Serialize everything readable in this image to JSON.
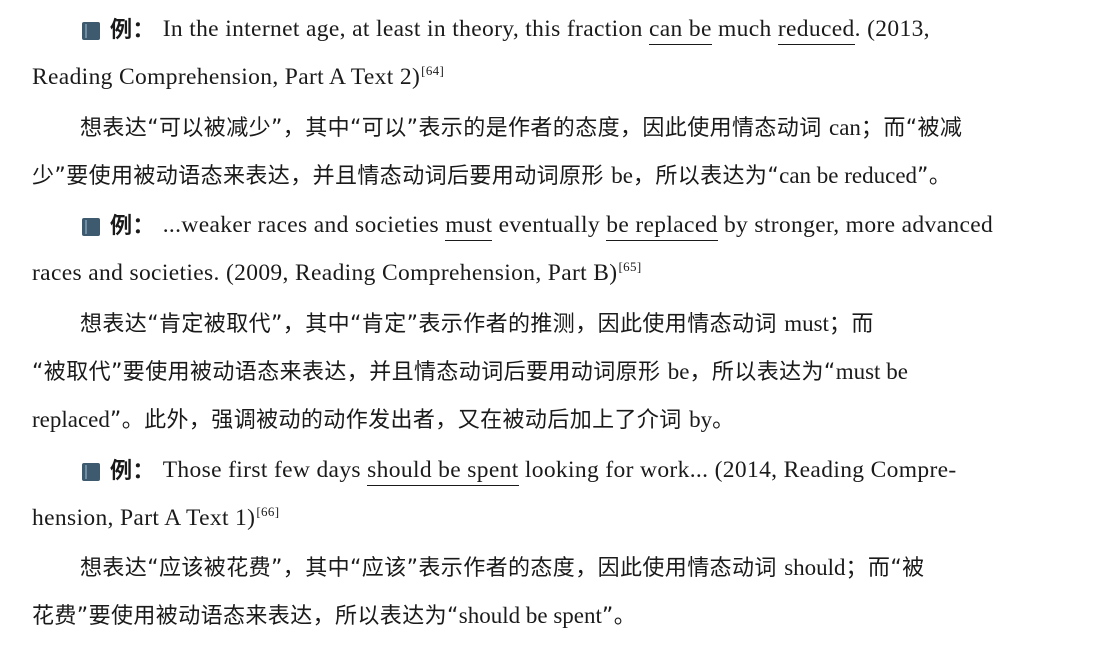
{
  "examples": [
    {
      "label": "例：",
      "sentence": {
        "l1": [
          "In the internet age, at least in theory, this fraction ",
          "can be",
          " much ",
          "reduced",
          ". (2013,"
        ],
        "l2": [
          "Reading Comprehension, Part A Text 2)",
          "[64]"
        ]
      },
      "explanation": {
        "l1": [
          "想表达“可以被减少”，其中“可以”表示的是作者的态度，因此使用情态动词 ",
          "can",
          "；而“被减"
        ],
        "l2": [
          "少”要使用被动语态来表达，并且情态动词后要用动词原形 ",
          "be",
          "，所以表达为“",
          "can be reduced",
          "”。"
        ]
      }
    },
    {
      "label": "例：",
      "sentence": {
        "l1": [
          "...weaker races and societies ",
          "must",
          " eventually ",
          "be replaced",
          " by stronger, more advanced"
        ],
        "l2": [
          "races and societies. (2009, Reading Comprehension, Part B)",
          "[65]"
        ]
      },
      "explanation": {
        "l1": [
          "想表达“肯定被取代”，其中“肯定”表示作者的推测，因此使用情态动词 ",
          "must",
          "；而"
        ],
        "l2": [
          "“被取代”要使用被动语态来表达，并且情态动词后要用动词原形 ",
          "be",
          "，所以表达为“",
          "must be"
        ],
        "l3": [
          "replaced",
          "”。此外，强调被动的动作发出者，又在被动后加上了介词 ",
          "by",
          "。"
        ]
      }
    },
    {
      "label": "例：",
      "sentence": {
        "l1": [
          "Those first few days ",
          "should be spent",
          " looking for work... (2014, Reading Compre-"
        ],
        "l2": [
          "hension, Part A Text 1)",
          "[66]"
        ]
      },
      "explanation": {
        "l1": [
          "想表达“应该被花费”，其中“应该”表示作者的态度，因此使用情态动词 ",
          "should",
          "；而“被"
        ],
        "l2": [
          "花费”要使用被动语态来表达，所以表达为“",
          "should be spent",
          "”。"
        ]
      }
    }
  ],
  "colors": {
    "icon": "#3d5a6e",
    "text": "#1a1a1a"
  },
  "icon_name": "book-icon"
}
